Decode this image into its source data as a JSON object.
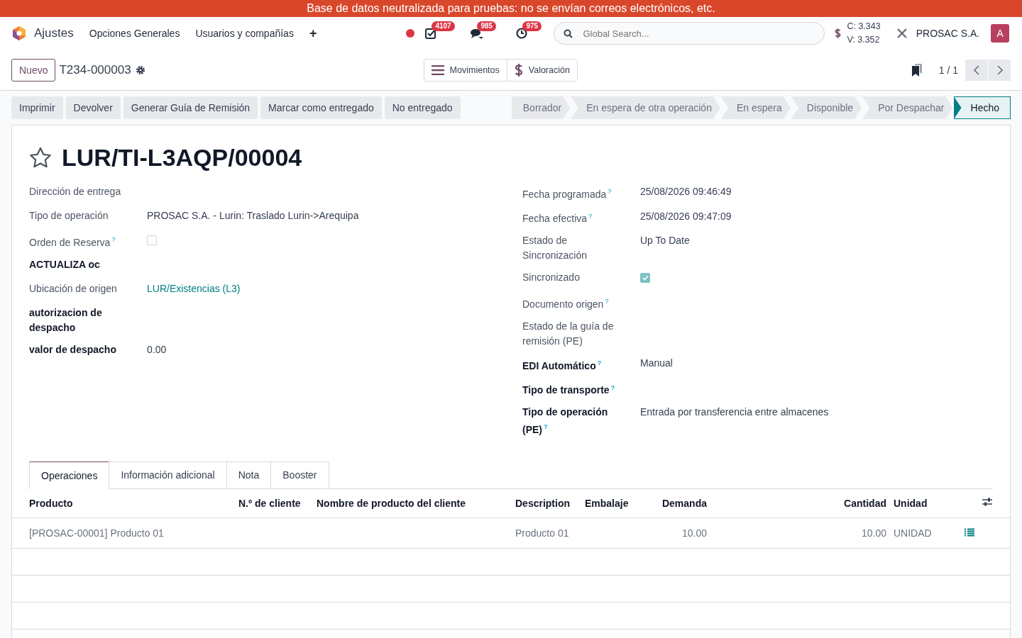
{
  "banner": "Base de datos neutralizada para pruebas: no se envían correos electrónicos, etc.",
  "navbar": {
    "app": "Ajustes",
    "menus": [
      "Opciones Generales",
      "Usuarios y compañías"
    ],
    "add": "+",
    "counters": [
      {
        "kind": "activity",
        "count": "4107"
      },
      {
        "kind": "chat",
        "count": "985"
      },
      {
        "kind": "clock",
        "count": "975"
      }
    ],
    "search": {
      "placeholder": "Global Search..."
    },
    "rates": [
      "C: 3.343",
      "V: 3.352"
    ],
    "company": "PROSAC S.A.",
    "avatar": "A"
  },
  "control": {
    "new": "Nuevo",
    "record": "T234-000003",
    "smart_buttons": [
      {
        "kind": "list",
        "label": "Movimientos"
      },
      {
        "kind": "money",
        "label": "Valoración"
      }
    ],
    "pager": "1 / 1"
  },
  "actions": [
    "Imprimir",
    "Devolver",
    "Generar Guía de Remisión",
    "Marcar como entregado",
    "No entregado"
  ],
  "stages": [
    {
      "label": "Borrador",
      "selected": false
    },
    {
      "label": "En espera de otra operación",
      "selected": false
    },
    {
      "label": "En espera",
      "selected": false
    },
    {
      "label": "Disponible",
      "selected": false
    },
    {
      "label": "Por Despachar",
      "selected": false
    },
    {
      "label": "Hecho",
      "selected": true
    }
  ],
  "title": "LUR/TI-L3AQP/00004",
  "starred": false,
  "left_fields": [
    {
      "label": "Dirección de entrega",
      "strong": false,
      "kind": "text"
    },
    {
      "label": "Tipo de operación",
      "strong": false,
      "kind": "text",
      "value": "PROSAC S.A. - Lurin: Traslado Lurin->Arequipa"
    },
    {
      "label": "Orden de Reserva",
      "help": "?",
      "strong": false,
      "kind": "checkbox",
      "checked": false
    },
    {
      "label": "ACTUALIZA oc",
      "strong": true,
      "kind": "text"
    },
    {
      "label": "Ubicación de origen",
      "strong": false,
      "kind": "link",
      "value": "LUR/Existencias (L3)"
    },
    {
      "label": "autorizacion de despacho",
      "strong": true,
      "kind": "text"
    },
    {
      "label": "valor de despacho",
      "strong": true,
      "kind": "text",
      "value": "0.00"
    }
  ],
  "right_fields": [
    {
      "label": "Fecha programada",
      "help": "?",
      "strong": false,
      "kind": "text",
      "value": "25/08/2026 09:46:49"
    },
    {
      "label": "Fecha efectiva",
      "help": "?",
      "strong": false,
      "kind": "text",
      "value": "25/08/2026 09:47:09"
    },
    {
      "label": "Estado de Sincronización",
      "strong": false,
      "kind": "text",
      "value": "Up To Date"
    },
    {
      "label": "Sincronizado",
      "strong": false,
      "kind": "checkbox",
      "checked": true
    },
    {
      "label": "Documento origen",
      "help": "?",
      "strong": false,
      "kind": "text"
    },
    {
      "label": "Estado de la guía de remisión (PE)",
      "strong": false,
      "kind": "text"
    },
    {
      "label": "EDI Automático",
      "help": "?",
      "strong": true,
      "kind": "text",
      "value": "Manual"
    },
    {
      "label": "Tipo de transporte",
      "help": "?",
      "strong": true,
      "kind": "text"
    },
    {
      "label": "Tipo de operación (PE)",
      "help": "?",
      "strong": true,
      "kind": "text",
      "value": "Entrada por transferencia entre almacenes"
    }
  ],
  "tabs": [
    {
      "label": "Operaciones",
      "selected": true
    },
    {
      "label": "Información adicional",
      "selected": false
    },
    {
      "label": "Nota",
      "selected": false
    },
    {
      "label": "Booster",
      "selected": false
    }
  ],
  "table": {
    "columns": [
      "Producto",
      "N.º de cliente",
      "Nombre de producto del cliente",
      "Description",
      "Embalaje",
      "Demanda",
      "Cantidad",
      "Unidad"
    ],
    "rows": [
      {
        "cells": [
          "[PROSAC-00001] Producto 01",
          "",
          "",
          "Producto 01",
          "",
          "10.00",
          "10.00",
          "UNIDAD"
        ]
      }
    ]
  }
}
